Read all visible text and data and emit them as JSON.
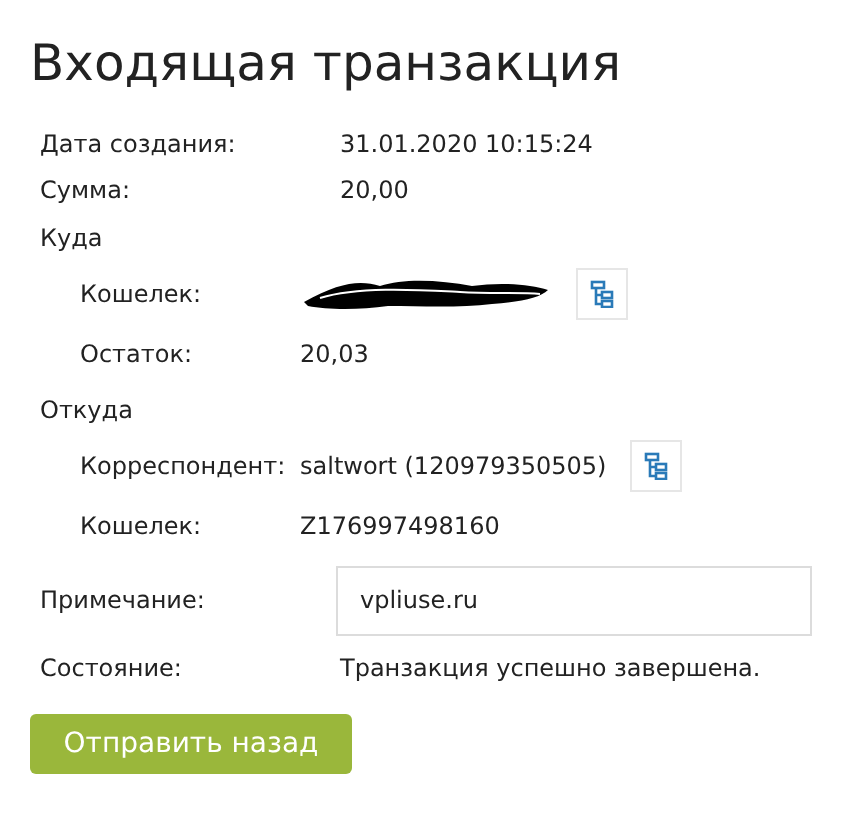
{
  "title": "Входящая транзакция",
  "rows": [
    {
      "kind": "field",
      "label": "Дата создания:",
      "value": "31.01.2020 10:15:24",
      "copy": false
    },
    {
      "kind": "field",
      "label": "Сумма:",
      "value": "20,00",
      "copy": false
    },
    {
      "kind": "section",
      "label": "Куда",
      "children": [
        {
          "kind": "redacted",
          "label": "Кошелек:",
          "copy": true
        },
        {
          "kind": "field",
          "label": "Остаток:",
          "value": "20,03",
          "copy": false
        }
      ]
    },
    {
      "kind": "section",
      "label": "Откуда",
      "children": [
        {
          "kind": "field",
          "label": "Корреспондент:",
          "value": "saltwort (120979350505)",
          "copy": true
        },
        {
          "kind": "field",
          "label": "Кошелек:",
          "value": "Z176997498160",
          "copy": false
        }
      ]
    },
    {
      "kind": "input",
      "label": "Примечание:",
      "value": "vpliuse.ru"
    },
    {
      "kind": "field",
      "label": "Состояние:",
      "value": "Транзакция успешно завершена.",
      "copy": false
    }
  ],
  "button": "Отправить назад"
}
